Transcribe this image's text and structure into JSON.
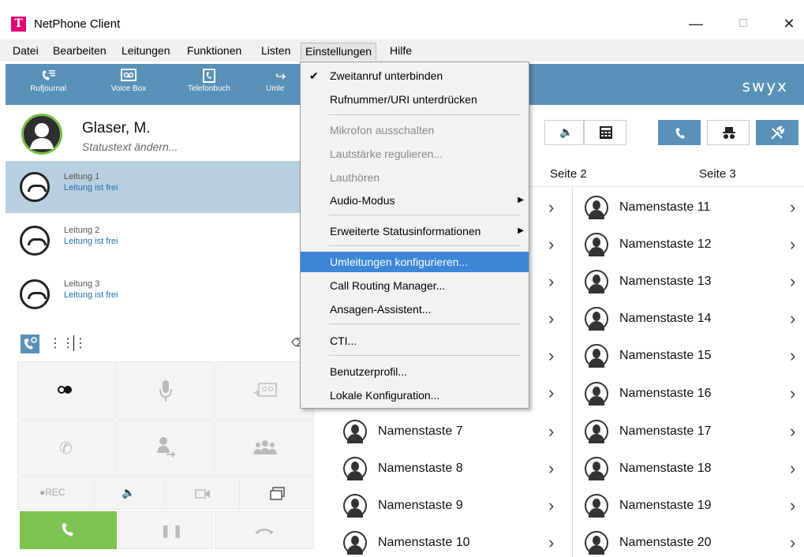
{
  "window": {
    "title": "NetPhone Client",
    "logo": "T"
  },
  "menubar": {
    "items": [
      "Datei",
      "Bearbeiten",
      "Leitungen",
      "Funktionen",
      "Listen",
      "Einstellungen",
      "Hilfe"
    ]
  },
  "toolbar": {
    "items": [
      "Rufjournal",
      "Voice Box",
      "Telefonbuch",
      "Umle"
    ],
    "brand": "swyx"
  },
  "user": {
    "name": "Glaser, M.",
    "status": "Statustext ändern..."
  },
  "lines": [
    {
      "title": "Leitung 1",
      "status": "Leitung ist frei"
    },
    {
      "title": "Leitung 2",
      "status": "Leitung ist frei"
    },
    {
      "title": "Leitung 3",
      "status": "Leitung ist frei"
    }
  ],
  "keypad": {
    "rec_label": "●REC"
  },
  "pages": [
    "Seite 2",
    "Seite 3"
  ],
  "name_keys": {
    "col2": [
      "Namenstaste 7",
      "Namenstaste 8",
      "Namenstaste 9",
      "Namenstaste 10"
    ],
    "col3": [
      "Namenstaste 11",
      "Namenstaste 12",
      "Namenstaste 13",
      "Namenstaste 14",
      "Namenstaste 15",
      "Namenstaste 16",
      "Namenstaste 17",
      "Namenstaste 18",
      "Namenstaste 19",
      "Namenstaste 20"
    ]
  },
  "dropdown": {
    "items": [
      {
        "label": "Zweitanruf unterbinden",
        "checked": true
      },
      {
        "label": "Rufnummer/URI unterdrücken"
      },
      {
        "label": "Mikrofon ausschalten",
        "disabled": true
      },
      {
        "label": "Lautstärke regulieren...",
        "disabled": true
      },
      {
        "label": "Lauthören",
        "disabled": true
      },
      {
        "label": "Audio-Modus",
        "submenu": true
      },
      {
        "label": "Erweiterte Statusinformationen",
        "submenu": true
      },
      {
        "label": "Umleitungen konfigurieren...",
        "highlighted": true
      },
      {
        "label": "Call Routing Manager..."
      },
      {
        "label": "Ansagen-Assistent..."
      },
      {
        "label": "CTI..."
      },
      {
        "label": "Benutzerprofil..."
      },
      {
        "label": "Lokale Konfiguration..."
      }
    ]
  },
  "colors": {
    "accent": "#5a91b8",
    "brand": "#e20074",
    "call": "#7dc352",
    "highlight": "#3d86d8"
  }
}
